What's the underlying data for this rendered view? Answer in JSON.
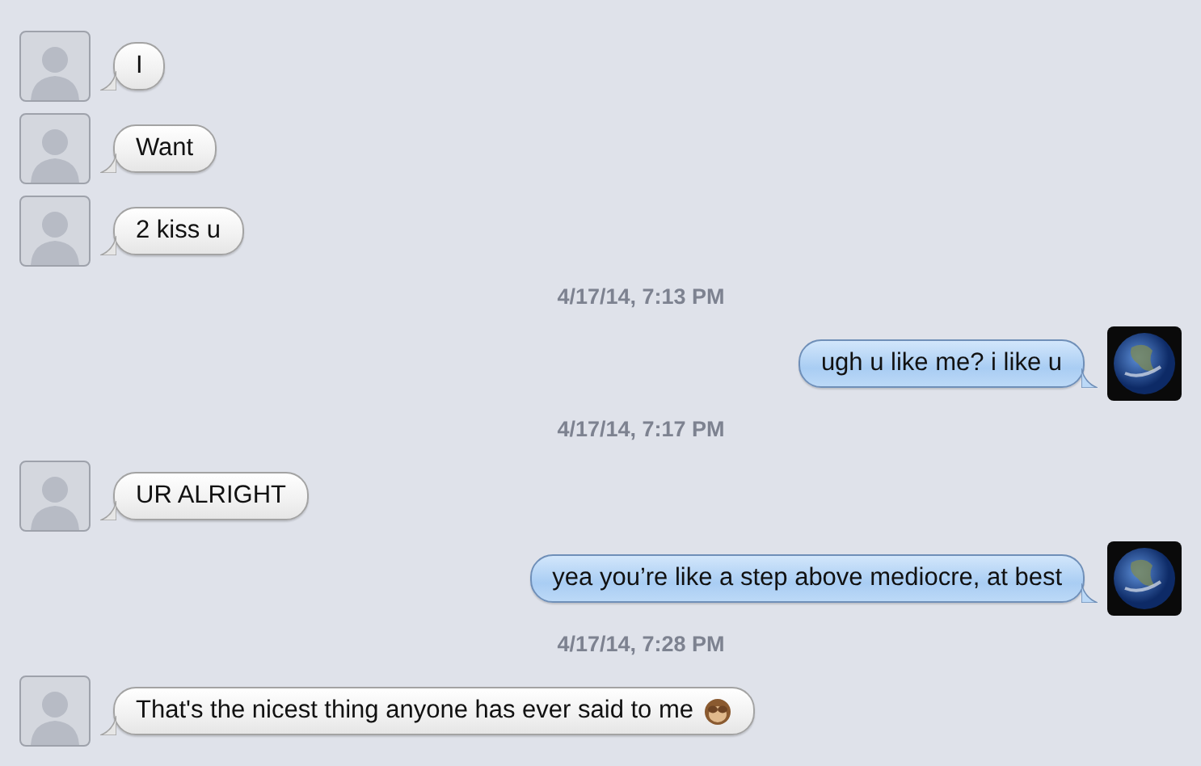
{
  "messages": [
    {
      "kind": "incoming",
      "text": "I"
    },
    {
      "kind": "incoming",
      "text": "Want"
    },
    {
      "kind": "incoming",
      "text": "2 kiss u"
    },
    {
      "kind": "timestamp",
      "text": "4/17/14, 7:13 PM"
    },
    {
      "kind": "outgoing",
      "text": "ugh u like me? i like u"
    },
    {
      "kind": "timestamp",
      "text": "4/17/14, 7:17 PM"
    },
    {
      "kind": "incoming",
      "text": "UR ALRIGHT"
    },
    {
      "kind": "outgoing",
      "text": "yea you’re like a step above mediocre, at best"
    },
    {
      "kind": "timestamp",
      "text": "4/17/14, 7:28 PM"
    },
    {
      "kind": "incoming_emoji",
      "text": "That's the nicest thing anyone has ever said to me"
    }
  ]
}
